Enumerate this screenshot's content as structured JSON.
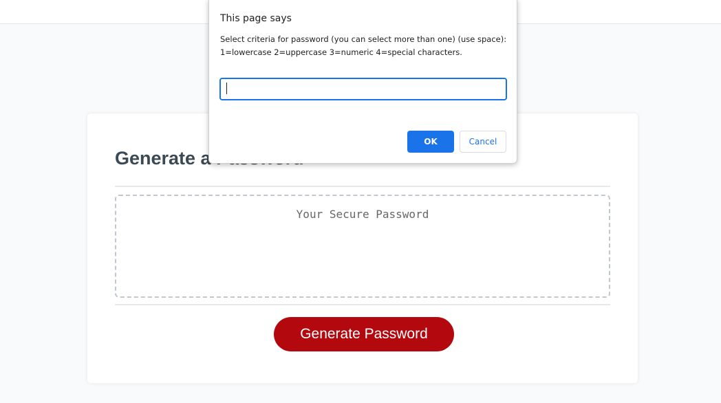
{
  "page": {
    "card": {
      "title": "Generate a Password",
      "password_placeholder": "Your Secure Password",
      "generate_label": "Generate Password"
    }
  },
  "dialog": {
    "title": "This page says",
    "message": "Select criteria for password (you can select more than one) (use space): 1=lowercase 2=uppercase 3=numeric 4=special characters.",
    "input_value": "",
    "ok_label": "OK",
    "cancel_label": "Cancel"
  },
  "colors": {
    "page_background": "#f9fafc",
    "generate_button": "#b2080e",
    "dialog_accent": "#1a73e8",
    "title_text": "#3b4751"
  }
}
